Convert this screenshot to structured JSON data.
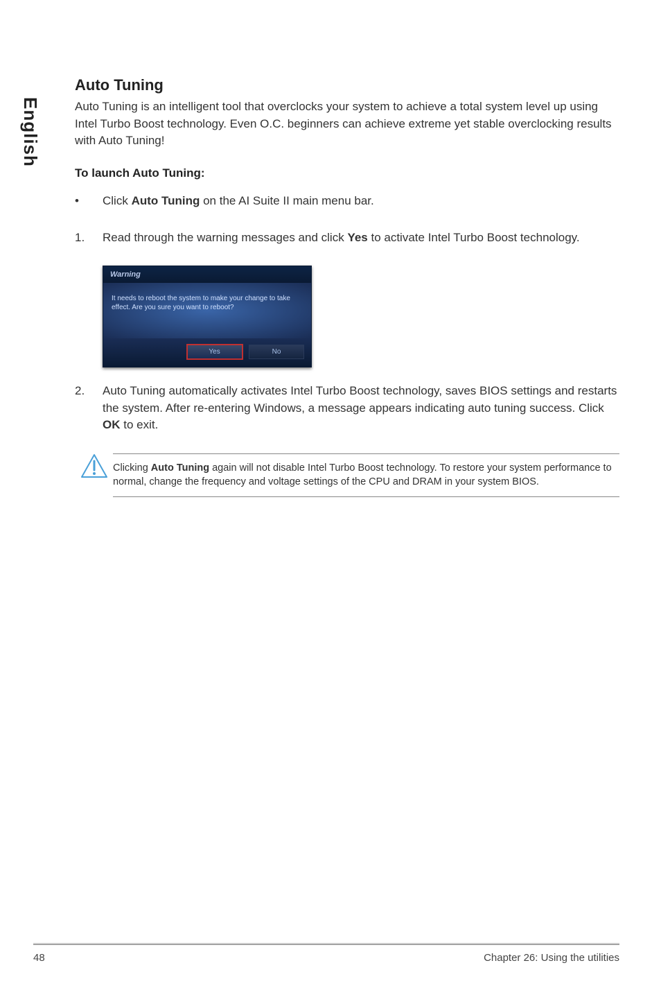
{
  "sideTab": "English",
  "heading": "Auto Tuning",
  "intro": "Auto Tuning is an intelligent tool that overclocks your system to achieve a total system level up using Intel Turbo Boost technology. Even O.C. beginners can achieve extreme yet stable overclocking results with Auto Tuning!",
  "launchHead": "To launch Auto Tuning:",
  "bulletMarker": "•",
  "bullet_pre": "Click ",
  "bullet_bold": "Auto Tuning",
  "bullet_post": " on the AI Suite II main menu bar.",
  "step1Marker": "1.",
  "step1_pre": "Read through the warning messages and click ",
  "step1_bold": "Yes",
  "step1_mid": " to activate ",
  "step1_tail": "Intel Turbo Boost technology.",
  "dialogTitle": "Warning",
  "dialogBody": "It needs to reboot the system to make your change to take effect. Are you sure you want to reboot?",
  "dialogYes": "Yes",
  "dialogNo": "No",
  "step2Marker": "2.",
  "step2_pre": "Auto Tuning automatically activates Intel Turbo Boost technology, saves BIOS settings and restarts the system. After re-entering Windows, a message appears indicating auto tuning success. Click ",
  "step2_bold": "OK",
  "step2_post": " to exit.",
  "note_pre": "Clicking ",
  "note_bold": "Auto Tuning",
  "note_post": " again will not disable Intel Turbo Boost technology. To restore your system performance to normal, change the frequency and voltage settings of the CPU and DRAM in your system BIOS.",
  "pageNum": "48",
  "chapter": "Chapter 26: Using the utilities"
}
